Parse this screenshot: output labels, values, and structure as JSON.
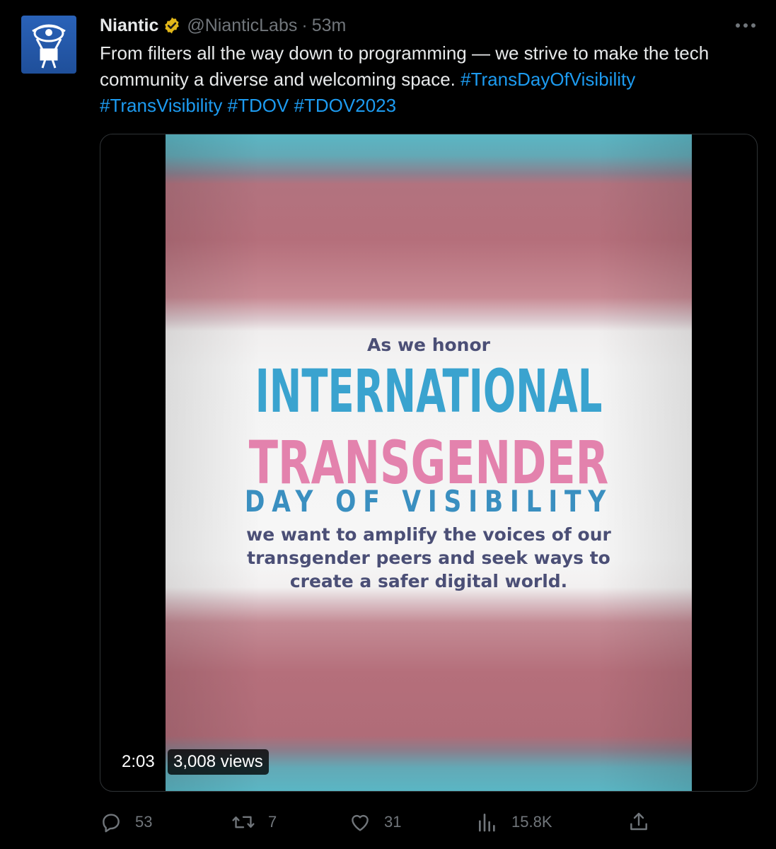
{
  "tweet": {
    "author_name": "Niantic",
    "author_handle": "@NianticLabs",
    "separator": "·",
    "time": "53m",
    "text_plain": "From filters all the way down to programming — we strive to make the tech community a diverse and welcoming space.",
    "hashtags": [
      "#TransDayOfVisibility",
      "#TransVisibility",
      "#TDOV",
      "#TDOV2023"
    ]
  },
  "media": {
    "line_honor": "As we honor",
    "line_international": "INTERNATIONAL",
    "line_transgender": "TRANSGENDER",
    "line_day": "DAY OF VISIBILITY",
    "message_lines": [
      "we want to amplify the voices of our",
      "transgender peers and seek ways to",
      "create a safer digital world."
    ],
    "duration": "2:03",
    "views": "3,008 views"
  },
  "actions": {
    "replies": "53",
    "retweets": "7",
    "likes": "31",
    "views": "15.8K"
  },
  "colors": {
    "background": "#000000",
    "link": "#1d9bf0",
    "muted": "#71767b",
    "verified_gold": "#e2b719",
    "trans_blue": "#5bcefa",
    "trans_pink": "#f5a9b8"
  },
  "icons": [
    "niantic-logo",
    "verified-badge-icon",
    "more-icon",
    "reply-icon",
    "retweet-icon",
    "like-icon",
    "analytics-icon",
    "share-icon"
  ]
}
